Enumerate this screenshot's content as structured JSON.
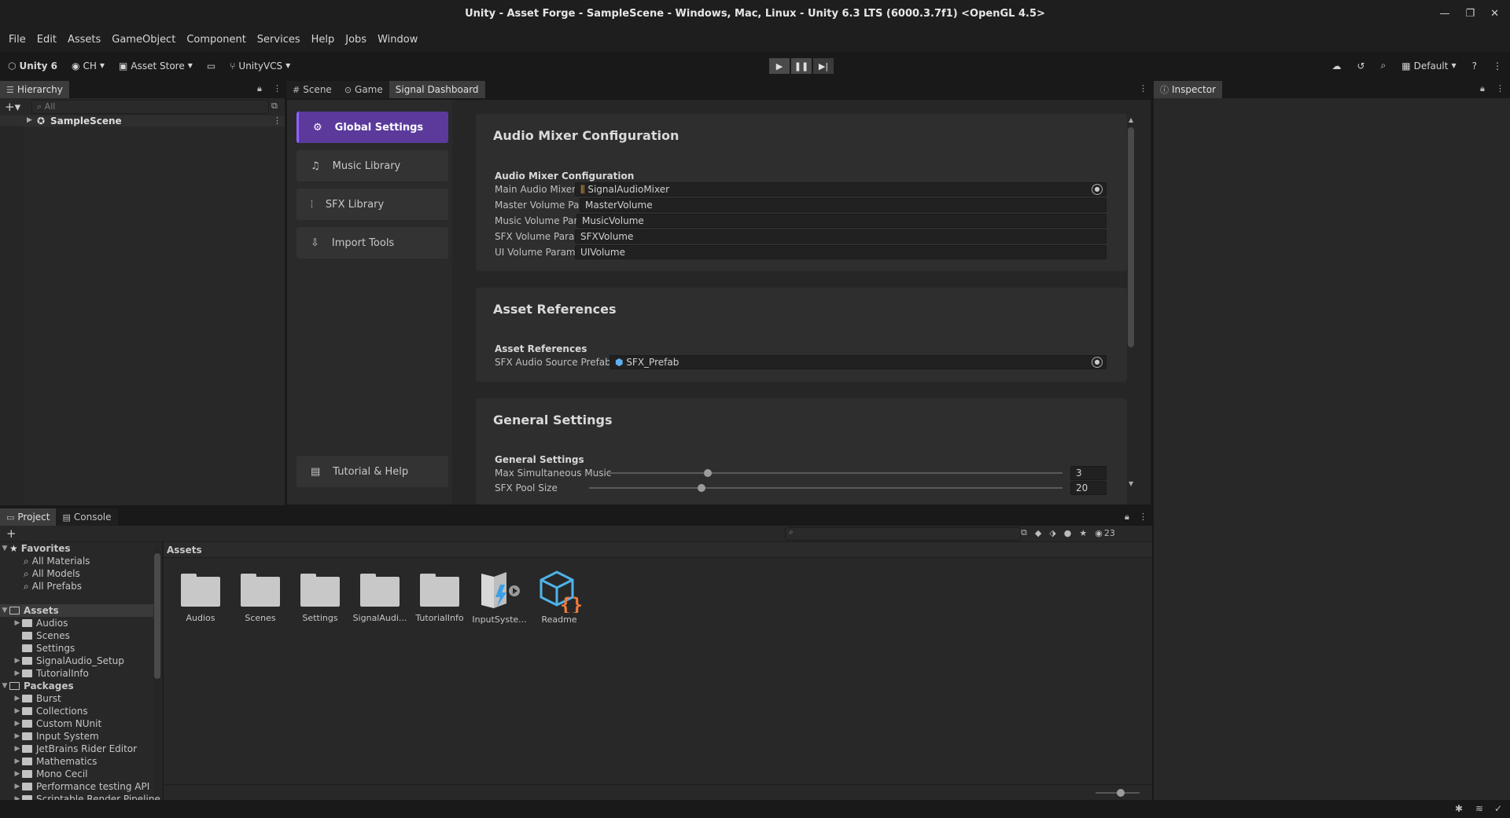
{
  "window": {
    "title": "Unity - Asset Forge - SampleScene - Windows, Mac, Linux - Unity 6.3 LTS (6000.3.7f1) <OpenGL 4.5>",
    "controls": {
      "minimize": "—",
      "restore": "❐",
      "close": "✕"
    }
  },
  "menu": [
    "File",
    "Edit",
    "Assets",
    "GameObject",
    "Component",
    "Services",
    "Help",
    "Jobs",
    "Window"
  ],
  "toolbar": {
    "unity_label": "Unity 6",
    "account_label": "CH",
    "asset_store_label": "Asset Store",
    "vcs_label": "UnityVCS",
    "layout_label": "Default"
  },
  "hierarchy": {
    "tab_label": "Hierarchy",
    "search_placeholder": "All",
    "scene_name": "SampleScene"
  },
  "center_tabs": {
    "scene": "Scene",
    "game": "Game",
    "signal": "Signal Dashboard"
  },
  "inspector": {
    "tab_label": "Inspector"
  },
  "dashboard": {
    "nav": [
      {
        "label": "Global Settings",
        "icon": "gear-icon"
      },
      {
        "label": "Music Library",
        "icon": "music-note-icon"
      },
      {
        "label": "SFX Library",
        "icon": "waveform-icon"
      },
      {
        "label": "Import Tools",
        "icon": "import-icon"
      }
    ],
    "help_label": "Tutorial & Help",
    "audio_section": {
      "title": "Audio Mixer Configuration",
      "subtitle": "Audio Mixer Configuration",
      "fields": [
        {
          "label": "Main Audio Mixer",
          "value": "SignalAudioMixer"
        },
        {
          "label": "Master Volume Param",
          "value": "MasterVolume"
        },
        {
          "label": "Music Volume Param",
          "value": "MusicVolume"
        },
        {
          "label": "SFX Volume Param",
          "value": "SFXVolume"
        },
        {
          "label": "UI Volume Param",
          "value": "UIVolume"
        }
      ]
    },
    "asset_section": {
      "title": "Asset References",
      "subtitle": "Asset References",
      "field_label": "SFX Audio Source Prefab",
      "field_value": "SFX_Prefab"
    },
    "general_section": {
      "title": "General Settings",
      "subtitle": "General Settings",
      "max_music_label": "Max Simultaneous Music",
      "max_music_value": "3",
      "max_music_level": 0.22,
      "sfx_pool_label": "SFX Pool Size",
      "sfx_pool_value": "20"
    }
  },
  "project": {
    "tabs": {
      "project": "Project",
      "console": "Console"
    },
    "hidden_count": "23",
    "breadcrumb": "Assets",
    "favorites": {
      "label": "Favorites",
      "items": [
        "All Materials",
        "All Models",
        "All Prefabs"
      ]
    },
    "assets_root": "Assets",
    "assets_children": [
      "Audios",
      "Scenes",
      "Settings",
      "SignalAudio_Setup",
      "TutorialInfo"
    ],
    "packages_root": "Packages",
    "packages_children": [
      "Burst",
      "Collections",
      "Custom NUnit",
      "Input System",
      "JetBrains Rider Editor",
      "Mathematics",
      "Mono Cecil",
      "Performance testing API",
      "Scriptable Render Pipeline"
    ],
    "grid": [
      "Audios",
      "Scenes",
      "Settings",
      "SignalAudi...",
      "TutorialInfo",
      "InputSyste...",
      "Readme"
    ]
  },
  "colors": {
    "accent": "#5b3a9c",
    "accent_border": "#8f63ff",
    "bg": "#191919",
    "panel": "#282828"
  }
}
